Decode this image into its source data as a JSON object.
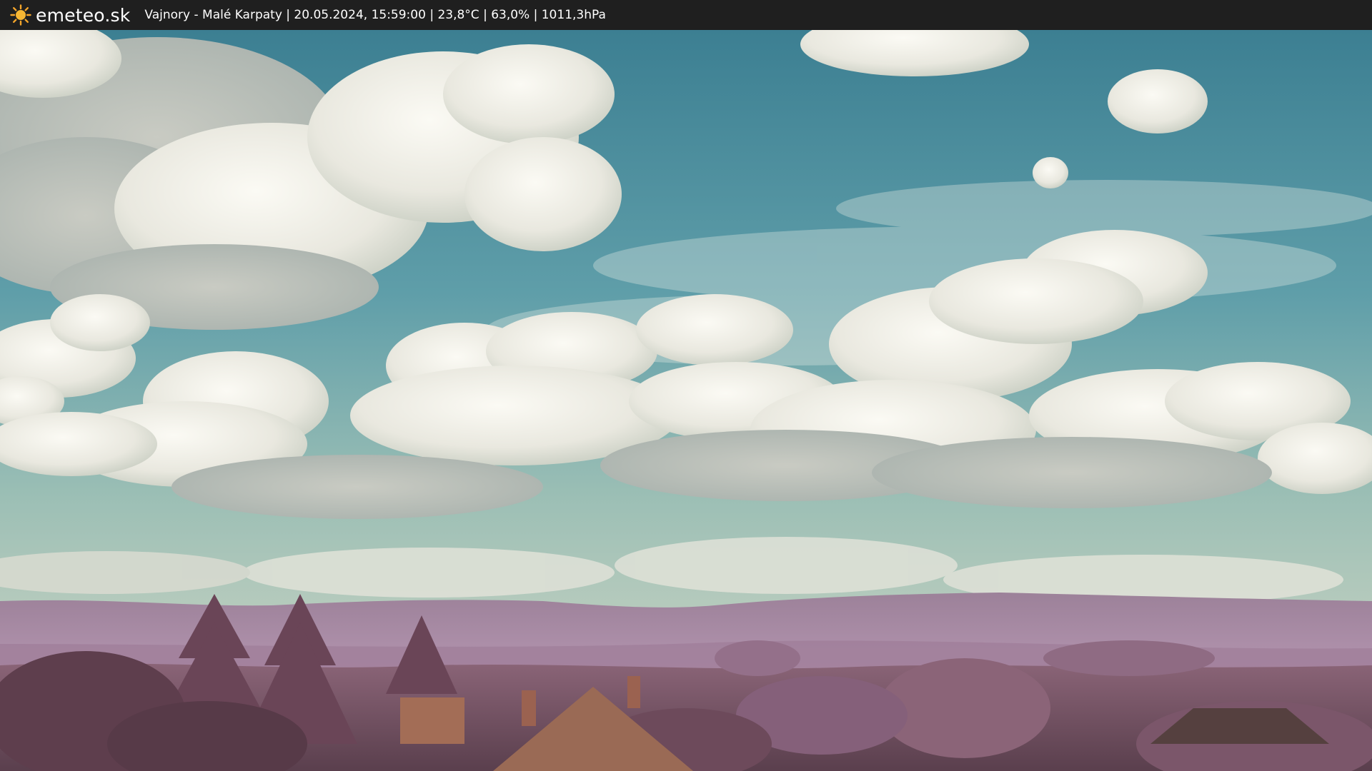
{
  "header": {
    "logo_icon": "sun-icon",
    "brand": "emeteo.sk",
    "info": "Vajnory - Malé Karpaty | 20.05.2024, 15:59:00 | 23,8°C | 63,0% | 1011,3hPa"
  },
  "colors": {
    "bar": "#1f1f1f",
    "sky_top": "#3f8496",
    "sky_bottom": "#a9c6bb",
    "cloud": "#f1f0ea",
    "hills": "#a98aa8",
    "foliage": "#7a5566",
    "roof": "#a06c52"
  }
}
